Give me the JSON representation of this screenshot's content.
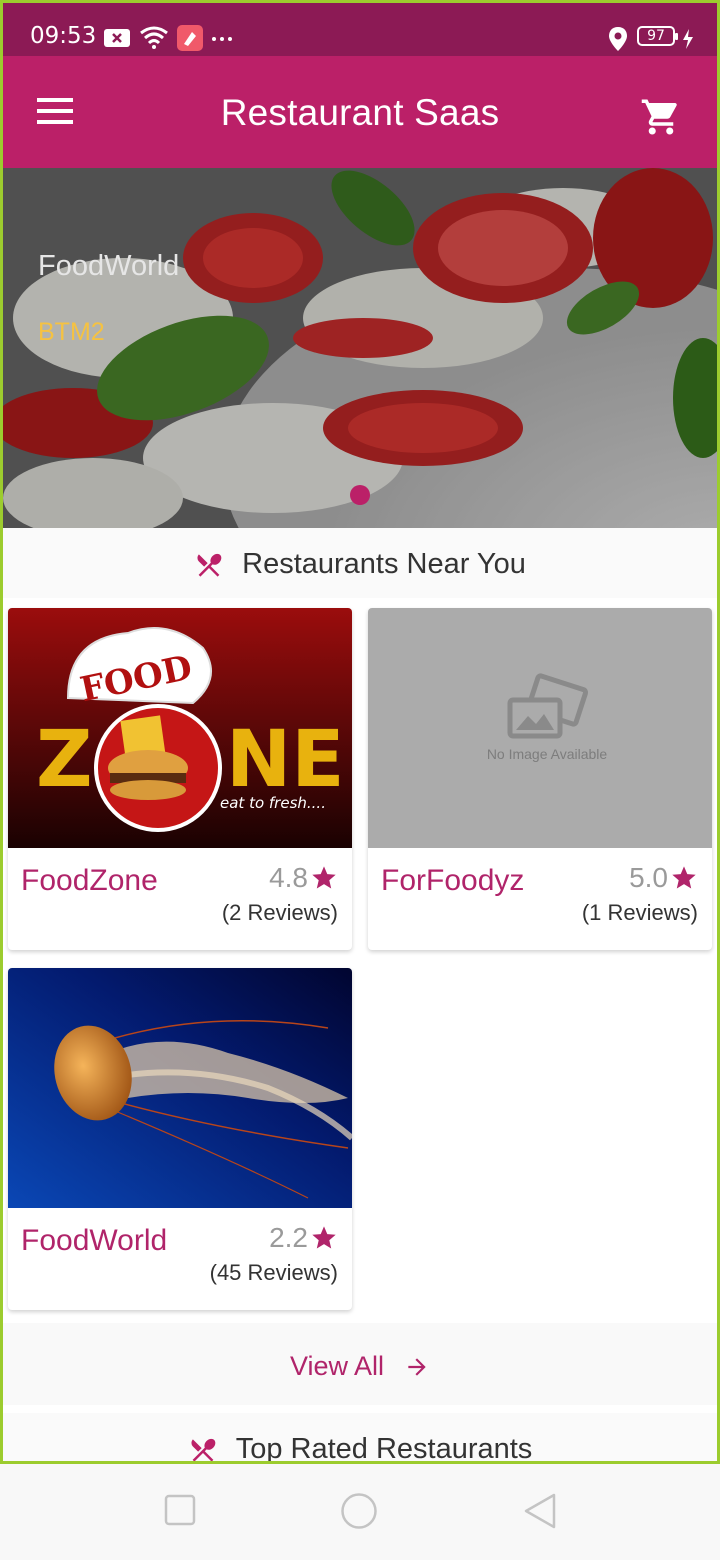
{
  "status_bar": {
    "time": "09:53",
    "battery": "97",
    "icons": [
      "notification-x-icon",
      "wifi-icon",
      "app-icon",
      "more-dots-icon",
      "location-icon",
      "charging-icon"
    ]
  },
  "app_bar": {
    "title": "Restaurant Saas",
    "menu_icon": "hamburger-menu-icon",
    "cart_icon": "shopping-cart-icon"
  },
  "hero": {
    "restaurant_name": "FoodWorld",
    "area": "BTM2"
  },
  "sections": {
    "near_you": "Restaurants Near You",
    "top_rated": "Top Rated Restaurants"
  },
  "restaurants": [
    {
      "name": "FoodZone",
      "rating": "4.8",
      "reviews": "(2 Reviews)",
      "image_text_1": "FOOD",
      "image_text_2": "Z",
      "image_text_3": "NE",
      "image_tagline": "eat to fresh...."
    },
    {
      "name": "ForFoodyz",
      "rating": "5.0",
      "reviews": "(1 Reviews)",
      "placeholder_text": "No Image Available"
    },
    {
      "name": "FoodWorld",
      "rating": "2.2",
      "reviews": "(45 Reviews)"
    }
  ],
  "view_all": {
    "label": "View All"
  },
  "colors": {
    "primary": "#bb2068",
    "status_bar": "#8c1a55",
    "accent_text": "#b0246a",
    "hero_area": "#f5c242"
  }
}
